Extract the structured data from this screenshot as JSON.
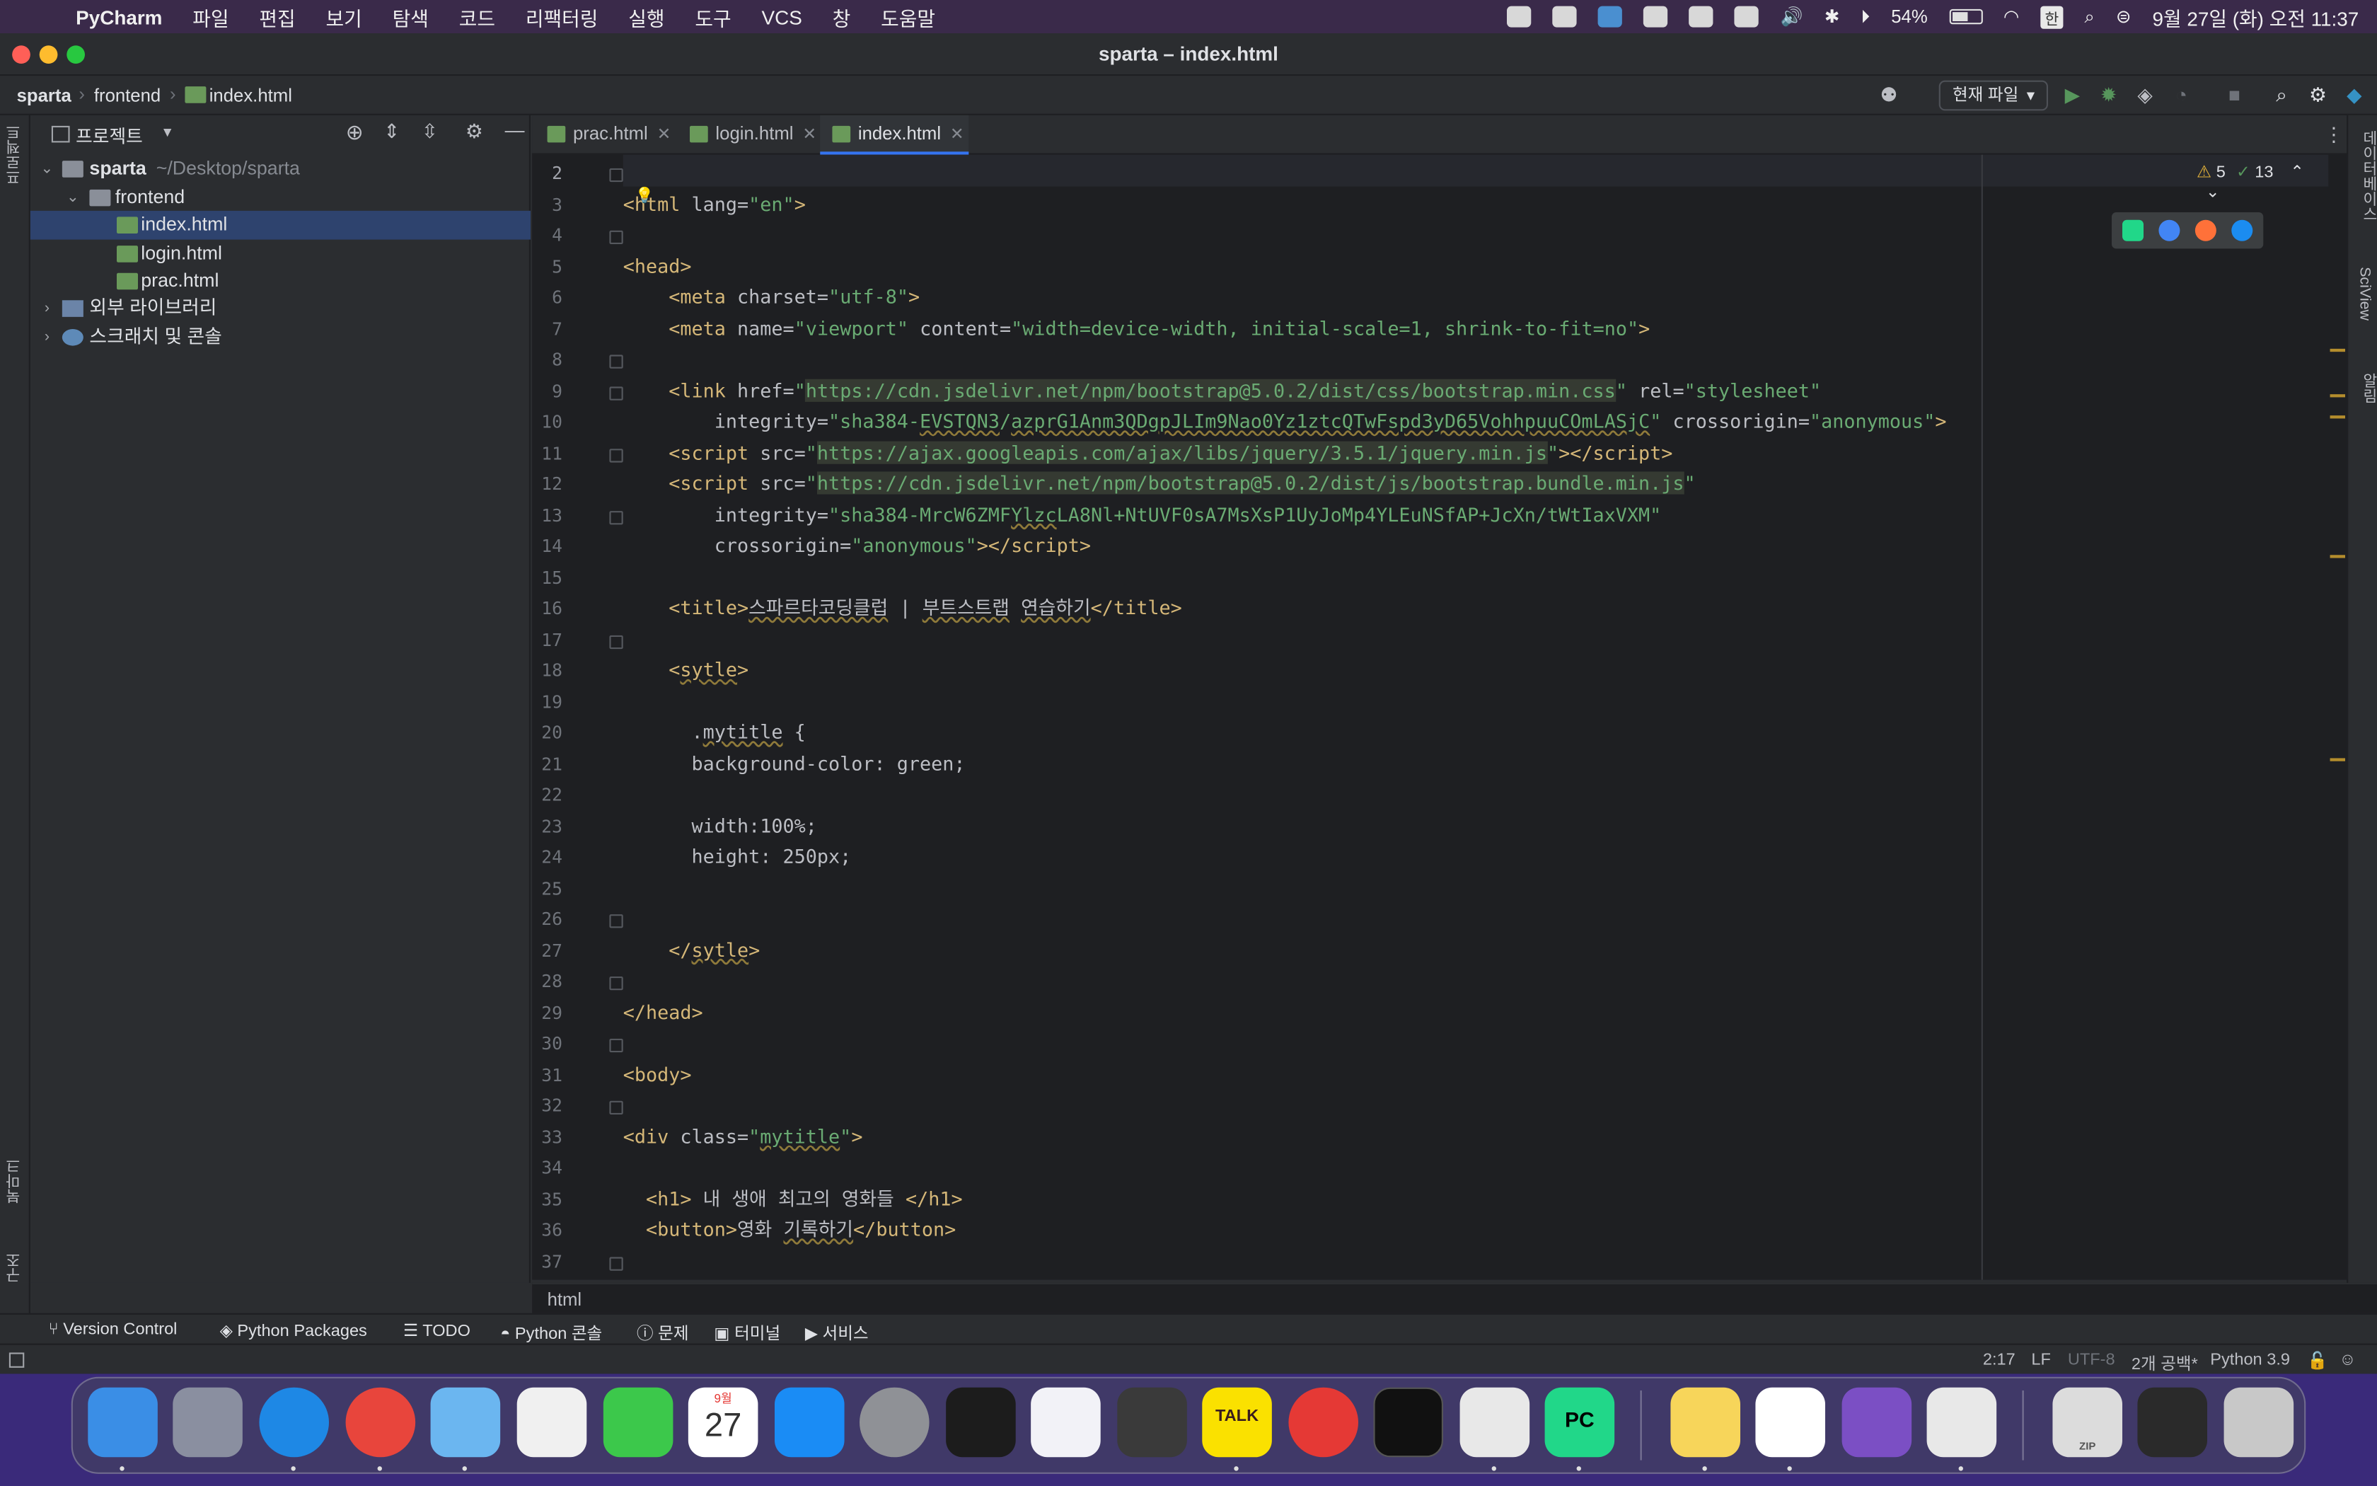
{
  "menubar": {
    "app": "PyCharm",
    "menus": [
      "파일",
      "편집",
      "보기",
      "탐색",
      "코드",
      "리팩터링",
      "실행",
      "도구",
      "VCS",
      "창",
      "도움말"
    ],
    "battery": "54%",
    "clock": "9월 27일 (화) 오전 11:37"
  },
  "window": {
    "title": "sparta – index.html"
  },
  "navbar": {
    "crumbs": [
      "sparta",
      "frontend",
      "index.html"
    ],
    "run_config": "현재 파일"
  },
  "project": {
    "header": "프로젝트",
    "tree": [
      {
        "label": "sparta",
        "hint": "~/Desktop/sparta"
      },
      {
        "label": "frontend"
      },
      {
        "label": "index.html"
      },
      {
        "label": "login.html"
      },
      {
        "label": "prac.html"
      },
      {
        "label": "외부 라이브러리"
      },
      {
        "label": "스크래치 및 콘솔"
      }
    ]
  },
  "left_strip": {
    "top": "프로젝트",
    "bookmarks": "북마크",
    "structure": "구조"
  },
  "right_strip": {
    "database": "데이터베이스",
    "sciview": "SciView",
    "notifications": "알림"
  },
  "tabs": [
    {
      "label": "prac.html"
    },
    {
      "label": "login.html"
    },
    {
      "label": "index.html"
    }
  ],
  "inspections": {
    "warnings": "5",
    "ok": "13"
  },
  "editor": {
    "line_numbers": [
      "2",
      "3",
      "4",
      "5",
      "6",
      "7",
      "8",
      "9",
      "10",
      "11",
      "12",
      "13",
      "14",
      "15",
      "16",
      "17",
      "18",
      "19",
      "20",
      "21",
      "22",
      "23",
      "24",
      "25",
      "26",
      "27",
      "28",
      "29",
      "30",
      "31",
      "32",
      "33",
      "34",
      "35",
      "36",
      "37"
    ],
    "current_line": "2"
  },
  "editor_breadcrumb": "html",
  "tool_windows": [
    "Version Control",
    "Python Packages",
    "TODO",
    "Python 콘솔",
    "문제",
    "터미널",
    "서비스"
  ],
  "status": {
    "position": "2:17",
    "line_sep": "LF",
    "encoding": "UTF-8",
    "indent": "2개 공백*",
    "interpreter": "Python 3.9"
  },
  "dock": {
    "calendar_month": "9월",
    "calendar_day": "27",
    "talk_label": "TALK",
    "pycharm_label": "PC",
    "zip_label": "ZIP"
  },
  "colors": {
    "tag": "#d5b778",
    "string": "#6aab73",
    "selection": "#2e436e",
    "tab_underline": "#3574f0"
  }
}
